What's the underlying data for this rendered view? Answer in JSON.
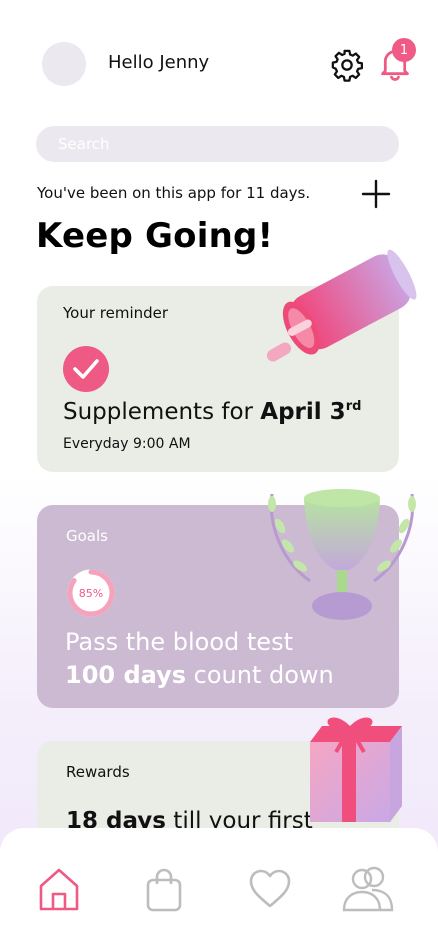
{
  "header": {
    "greeting": "Hello Jenny",
    "notification_count": "1",
    "avatar_icon": "avatar-placeholder",
    "settings_icon": "gear-icon",
    "notifications_icon": "bell-icon"
  },
  "search": {
    "placeholder": "Search"
  },
  "streak": {
    "text": "You've been on this app for 11 days.",
    "add_icon": "plus-icon"
  },
  "headline": "Keep Going!",
  "reminder": {
    "title": "Your reminder",
    "text_prefix": "Supplements for ",
    "date": "April 3",
    "date_suffix": "rd",
    "schedule": "Everyday 9:00 AM",
    "done": true
  },
  "goals": {
    "title": "Goals",
    "progress_label": "85%",
    "progress": 0.85,
    "line1": "Pass the blood test",
    "line2_bold": "100 days",
    "line2_rest": " count down"
  },
  "rewards": {
    "title": "Rewards",
    "text_bold": "18 days",
    "text_rest": " till your first"
  },
  "tabs": [
    {
      "icon": "home-icon",
      "active": true
    },
    {
      "icon": "shopping-bag-icon",
      "active": false
    },
    {
      "icon": "heart-icon",
      "active": false
    },
    {
      "icon": "community-icon",
      "active": false
    }
  ],
  "colors": {
    "accent": "#ef5a84",
    "goal_card": "#cbbad2",
    "card": "#e9ede5",
    "muted": "#ece8ef"
  }
}
